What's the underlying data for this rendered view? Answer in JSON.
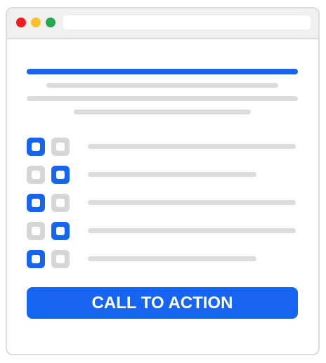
{
  "colors": {
    "accent": "#1565f0",
    "placeholder": "#dcdcdc",
    "checkbox_off": "#d6d6d6",
    "dot_red": "#f41d1d",
    "dot_yellow": "#fbc02d",
    "dot_green": "#22a94b"
  },
  "checklist": [
    {
      "left_checked": true,
      "right_checked": false
    },
    {
      "left_checked": false,
      "right_checked": true
    },
    {
      "left_checked": true,
      "right_checked": false
    },
    {
      "left_checked": false,
      "right_checked": true
    },
    {
      "left_checked": true,
      "right_checked": false
    }
  ],
  "cta": {
    "label": "CALL TO ACTION"
  }
}
